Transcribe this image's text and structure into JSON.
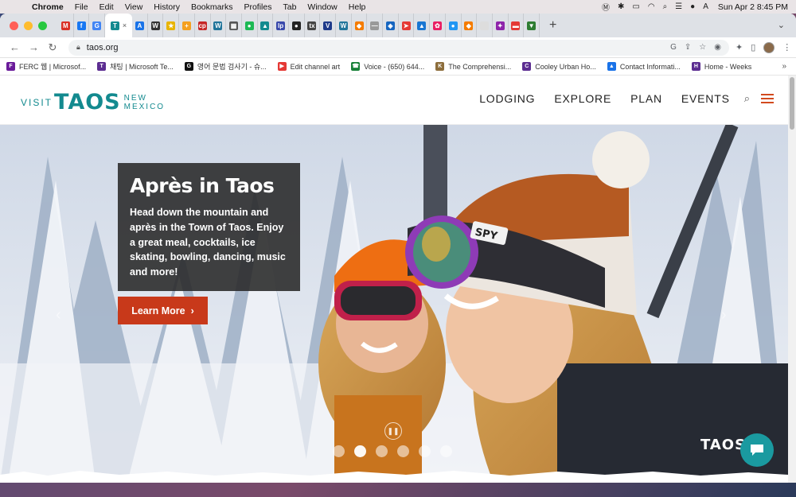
{
  "menubar": {
    "app": "Chrome",
    "items": [
      "File",
      "Edit",
      "View",
      "History",
      "Bookmarks",
      "Profiles",
      "Tab",
      "Window",
      "Help"
    ],
    "clock": "Sun Apr 2  8:45 PM"
  },
  "tabs": {
    "favicons": [
      {
        "icon": "gmail-icon",
        "glyph": "M",
        "color": "#d93025"
      },
      {
        "icon": "facebook-icon",
        "glyph": "f",
        "color": "#1877f2"
      },
      {
        "icon": "google-icon",
        "glyph": "G",
        "color": "#4285f4"
      },
      {
        "icon": "taos-icon",
        "glyph": "T",
        "color": "#138a8f",
        "active": true
      },
      {
        "icon": "a-icon",
        "glyph": "A",
        "color": "#1a73e8"
      },
      {
        "icon": "wikipedia-icon",
        "glyph": "W",
        "color": "#333333"
      },
      {
        "icon": "star-icon",
        "glyph": "★",
        "color": "#e8b400"
      },
      {
        "icon": "plus-icon",
        "glyph": "+",
        "color": "#f4a020"
      },
      {
        "icon": "cp-icon",
        "glyph": "cp",
        "color": "#c62828"
      },
      {
        "icon": "wordpress-icon",
        "glyph": "W",
        "color": "#21759b"
      },
      {
        "icon": "grid-icon",
        "glyph": "▦",
        "color": "#555555"
      },
      {
        "icon": "spotify-icon",
        "glyph": "●",
        "color": "#1db954"
      },
      {
        "icon": "bird-icon",
        "glyph": "▲",
        "color": "#138a8f"
      },
      {
        "icon": "lp-icon",
        "glyph": "lp",
        "color": "#3949ab"
      },
      {
        "icon": "dark-circle-icon",
        "glyph": "●",
        "color": "#222222"
      },
      {
        "icon": "text-icon",
        "glyph": "tx",
        "color": "#444444"
      },
      {
        "icon": "vw-icon",
        "glyph": "V",
        "color": "#1e3a8a"
      },
      {
        "icon": "wordpress-icon",
        "glyph": "W",
        "color": "#21759b"
      },
      {
        "icon": "orange-diamond-icon",
        "glyph": "◆",
        "color": "#f57c00"
      },
      {
        "icon": "dash-icon",
        "glyph": "—",
        "color": "#999999"
      },
      {
        "icon": "shield-icon",
        "glyph": "◈",
        "color": "#1565c0"
      },
      {
        "icon": "arrow-icon",
        "glyph": "➤",
        "color": "#e53935"
      },
      {
        "icon": "mountain-icon",
        "glyph": "▲",
        "color": "#1976d2"
      },
      {
        "icon": "flower-icon",
        "glyph": "✿",
        "color": "#e91e63"
      },
      {
        "icon": "blue-dot-icon",
        "glyph": "●",
        "color": "#2196f3"
      },
      {
        "icon": "brave-icon",
        "glyph": "◆",
        "color": "#f57c00"
      },
      {
        "icon": "blank-icon",
        "glyph": "",
        "color": "#dddddd"
      },
      {
        "icon": "colorful-icon",
        "glyph": "✦",
        "color": "#8e24aa"
      },
      {
        "icon": "red-text-icon",
        "glyph": "▬",
        "color": "#e53935"
      },
      {
        "icon": "green-arrow-icon",
        "glyph": "▼",
        "color": "#2e7d32"
      }
    ],
    "active_close": "×"
  },
  "toolbar": {
    "url": "taos.org"
  },
  "bookmarks": [
    {
      "label": "FERC 웹 | Microsof...",
      "color": "#6a1b9a",
      "glyph": "F"
    },
    {
      "label": "채팅 | Microsoft Te...",
      "color": "#5c2d91",
      "glyph": "T"
    },
    {
      "label": "영어 문법 검사기 - 슈...",
      "color": "#111111",
      "glyph": "G"
    },
    {
      "label": "Edit channel art",
      "color": "#e53935",
      "glyph": "▶"
    },
    {
      "label": "Voice - (650) 644...",
      "color": "#188038",
      "glyph": "☎"
    },
    {
      "label": "The Comprehensi...",
      "color": "#8d6e3c",
      "glyph": "K"
    },
    {
      "label": "Cooley Urban Ho...",
      "color": "#5c2d91",
      "glyph": "C"
    },
    {
      "label": "Contact Informati...",
      "color": "#1a73e8",
      "glyph": "▲"
    },
    {
      "label": "Home - Weeks",
      "color": "#5c2d91",
      "glyph": "H"
    }
  ],
  "site": {
    "logo": {
      "visit": "VISIT",
      "taos": "TAOS",
      "nm_line1": "NEW",
      "nm_line2": "MEXICO"
    },
    "nav": [
      "LODGING",
      "EXPLORE",
      "PLAN",
      "EVENTS"
    ],
    "accent": "#c8391a",
    "brand": "#138a8f"
  },
  "hero": {
    "title": "Après in Taos",
    "body": "Head down the mountain and après in the Town of Taos. Enjoy a great meal, cocktails, ice skating, bowling, dancing, music and more!",
    "cta": "Learn More",
    "cta_chevron": "›",
    "slides": 6,
    "active_slide": 2,
    "watermark": "TAOS"
  }
}
